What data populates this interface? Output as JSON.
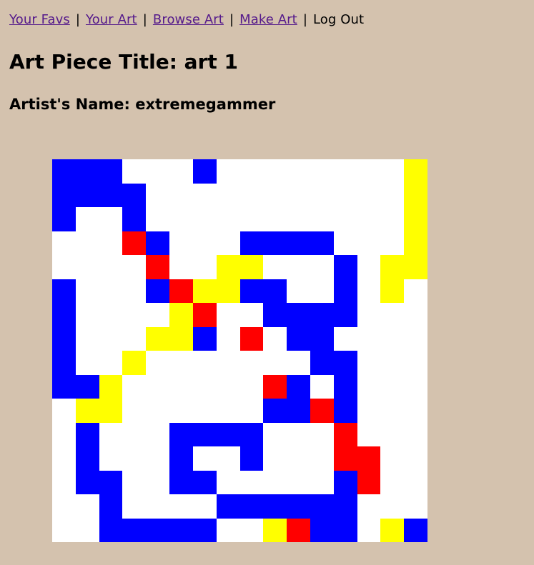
{
  "nav": {
    "items": [
      {
        "label": "Your Favs",
        "link": true
      },
      {
        "label": "Your Art",
        "link": true
      },
      {
        "label": "Browse Art",
        "link": true
      },
      {
        "label": "Make Art",
        "link": true
      }
    ],
    "logout_label": "Log Out",
    "separator": "|"
  },
  "art": {
    "title_line": "Art Piece Title: art 1",
    "artist_line": "Artist's Name: extremegammer",
    "palette": {
      "W": "#ffffff",
      "B": "#0000ff",
      "Y": "#ffff00",
      "R": "#ff0000"
    },
    "grid": [
      "BBBWWWBWWWWWWWWY",
      "BBBBWWWWWWWWWWWY",
      "BWWBWWWWWWWWWWWY",
      "WWWRBWWWBBBBWWWY",
      "WWWWRWWYYWWWBWYY",
      "BWWWBRYYBBWWBWYW",
      "BWWWWYRWWBBBBWWW",
      "BWWWYYBWRWBBWWWW",
      "BWWYWWWWWWWBBWWW",
      "BBYWWWWWWRBWBWWW",
      "WYYWWWWWWBBRBWWW",
      "WBWWWBBBBWWWRWWW",
      "WBWWWBWWBWWWRRWW",
      "WBBWWBBWWWWWBRWW",
      "WWBWWWWBBBBBBWWW",
      "WWBBBBBWWYRBBWYB"
    ]
  }
}
